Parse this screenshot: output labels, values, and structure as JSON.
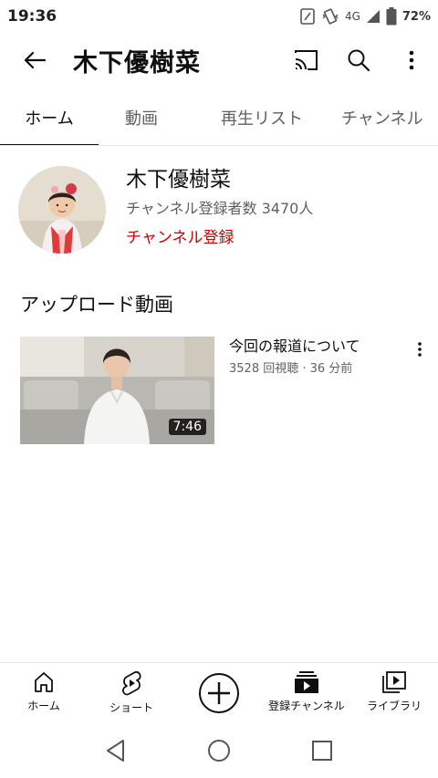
{
  "status_bar": {
    "time": "19:36",
    "network": "4G",
    "battery": "72%"
  },
  "app_bar": {
    "title": "木下優樹菜"
  },
  "tabs": [
    {
      "label": "ホーム",
      "active": true
    },
    {
      "label": "動画",
      "active": false
    },
    {
      "label": "再生リスト",
      "active": false
    },
    {
      "label": "チャンネル",
      "active": false
    }
  ],
  "channel": {
    "name": "木下優樹菜",
    "subscribers": "チャンネル登録者数 3470人",
    "subscribe_label": "チャンネル登録",
    "subscribe_color": "#cc0000"
  },
  "section": {
    "title": "アップロード動画"
  },
  "video": {
    "title": "今回の報道について",
    "meta": "3528 回視聴 · 36 分前",
    "duration": "7:46"
  },
  "bottom_nav": [
    {
      "label": "ホーム",
      "icon": "home-icon"
    },
    {
      "label": "ショート",
      "icon": "shorts-icon"
    },
    {
      "label": "",
      "icon": "create-icon"
    },
    {
      "label": "登録チャンネル",
      "icon": "subscriptions-icon"
    },
    {
      "label": "ライブラリ",
      "icon": "library-icon"
    }
  ]
}
